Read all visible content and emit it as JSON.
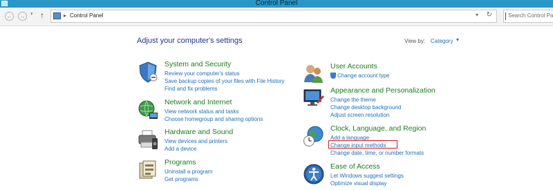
{
  "window": {
    "title": "Control Panel"
  },
  "nav": {
    "back_icon": "back-arrow-icon",
    "forward_icon": "forward-arrow-icon",
    "up_icon": "up-arrow-icon",
    "breadcrumb": "Control Panel",
    "search_placeholder": "Search Control Panel"
  },
  "main": {
    "heading": "Adjust your computer's settings",
    "view_by_label": "View by:",
    "view_by_value": "Category",
    "categories": [
      {
        "title": "System and Security",
        "icon": "shield-icon",
        "links": [
          "Review your computer's status",
          "Save backup copies of your files with File History",
          "Find and fix problems"
        ]
      },
      {
        "title": "Network and Internet",
        "icon": "network-globe-icon",
        "links": [
          "View network status and tasks",
          "Choose homegroup and sharing options"
        ]
      },
      {
        "title": "Hardware and Sound",
        "icon": "printer-icon",
        "links": [
          "View devices and printers",
          "Add a device"
        ]
      },
      {
        "title": "Programs",
        "icon": "programs-icon",
        "links": [
          "Uninstall a program",
          "Get programs"
        ]
      },
      {
        "title": "User Accounts",
        "icon": "users-icon",
        "links": [
          "Change account type"
        ]
      },
      {
        "title": "Appearance and Personalization",
        "icon": "monitor-brush-icon",
        "links": [
          "Change the theme",
          "Change desktop background",
          "Adjust screen resolution"
        ]
      },
      {
        "title": "Clock, Language, and Region",
        "icon": "globe-clock-icon",
        "links": [
          "Add a language",
          "Change input methods",
          "Change date, time, or number formats"
        ]
      },
      {
        "title": "Ease of Access",
        "icon": "ease-of-access-icon",
        "links": [
          "Let Windows suggest settings",
          "Optimize visual display"
        ]
      }
    ]
  },
  "colors": {
    "titlebar": "#2a96c8",
    "category_title": "#1e7a1e",
    "link": "#1e6eb4",
    "heading": "#1e3287",
    "highlight": "#d4151b"
  }
}
